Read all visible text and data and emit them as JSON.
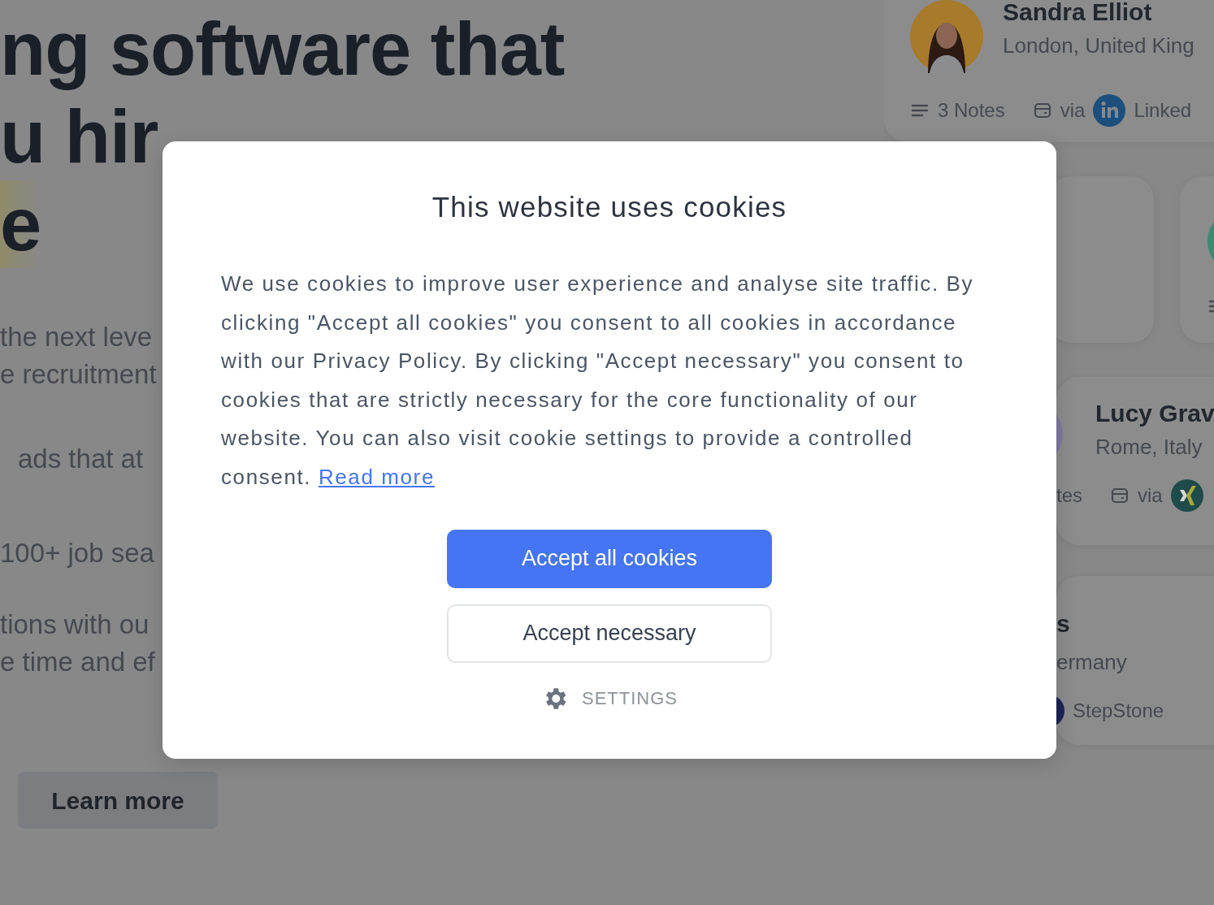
{
  "page": {
    "headline": [
      "ng software that",
      "u hir",
      "e"
    ],
    "paragraphs": [
      [
        "the next leve",
        "e recruitment"
      ],
      [
        "ads that at"
      ],
      [
        "100+ job sea"
      ],
      [
        "tions with ou",
        "e time and ef"
      ]
    ],
    "learn_more": "Learn more"
  },
  "candidates": [
    {
      "kind": "full",
      "name": "Sandra Elliot",
      "location": "London, United King",
      "notes": "3 Notes",
      "via": "via",
      "source": "Linked",
      "color": "#1d4f7c"
    },
    {
      "kind": "empty"
    },
    {
      "kind": "edge",
      "color": "#3b8a74"
    },
    {
      "kind": "full",
      "name": "Lucy Grav",
      "location": "Rome, Italy",
      "notes": "tes",
      "via": "via",
      "color": "#1f4b4a"
    },
    {
      "kind": "tail",
      "name": "s",
      "location": "ermany",
      "source": "StepStone",
      "color": "#1c2458"
    }
  ],
  "cookie_dialog": {
    "title": "This website uses cookies",
    "text": "We use cookies to improve user experience and analyse site traffic. By clicking \"Accept all cookies\" you consent to all cookies in accordance with our Privacy Policy. By clicking \"Accept necessary\" you consent to cookies that are strictly necessary for the core functionality of our website. You can also visit cookie settings to provide a controlled consent.",
    "link": "Read more",
    "buttons": [
      {
        "kind": "primary",
        "label": "Accept all cookies"
      },
      {
        "kind": "outline",
        "label": "Accept necessary"
      }
    ],
    "settings": "SETTINGS"
  }
}
